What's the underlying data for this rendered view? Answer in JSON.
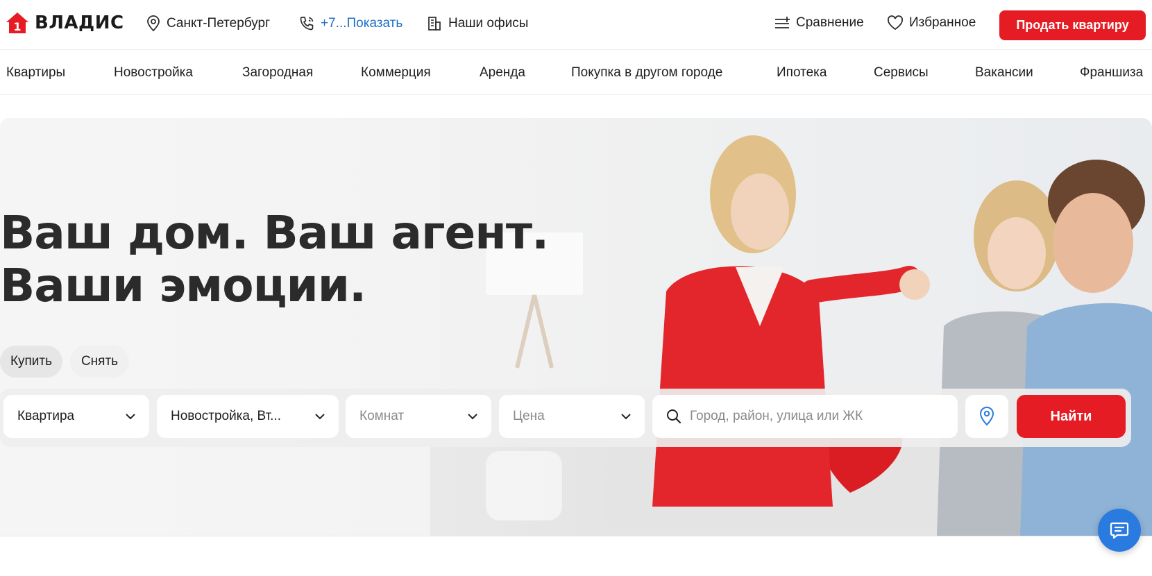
{
  "header": {
    "logo_text": "ВЛАДИС",
    "logo_digit": "1",
    "city": "Санкт-Петербург",
    "phone": "+7...Показать",
    "offices": "Наши офисы",
    "compare": "Сравнение",
    "favorites": "Избранное",
    "sell_button": "Продать квартиру"
  },
  "nav": {
    "items": [
      {
        "label": "Квартиры"
      },
      {
        "label": "Новостройка"
      },
      {
        "label": "Загородная"
      },
      {
        "label": "Коммерция"
      },
      {
        "label": "Аренда"
      },
      {
        "label": "Покупка в другом городе"
      },
      {
        "label": "Ипотека"
      },
      {
        "label": "Сервисы"
      },
      {
        "label": "Вакансии"
      },
      {
        "label": "Франшиза"
      }
    ]
  },
  "hero": {
    "title_line1": "Ваш дом. Ваш агент.",
    "title_line2": "Ваши эмоции.",
    "tabs": [
      {
        "label": "Купить",
        "active": true
      },
      {
        "label": "Снять",
        "active": false
      }
    ]
  },
  "search": {
    "property_type": "Квартира",
    "market": "Новостройка, Вт...",
    "rooms_placeholder": "Комнат",
    "price_placeholder": "Цена",
    "location_placeholder": "Город, район, улица или ЖК",
    "submit": "Найти"
  },
  "colors": {
    "accent": "#e51c23",
    "link": "#1e6fc9",
    "chat": "#2a7be0"
  },
  "icons": [
    "location-pin-icon",
    "phone-icon",
    "office-building-icon",
    "compare-icon",
    "heart-icon",
    "chevron-down-icon",
    "search-icon",
    "map-pin-icon",
    "chat-icon"
  ]
}
